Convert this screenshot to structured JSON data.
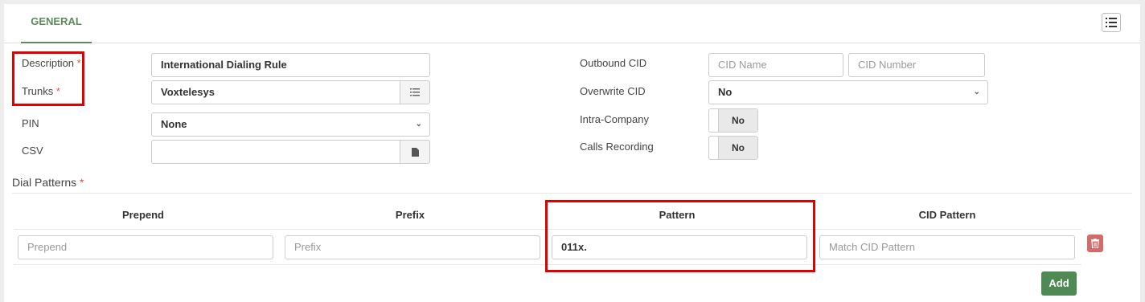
{
  "tabs": [
    {
      "label": "GENERAL"
    }
  ],
  "form": {
    "description": {
      "label": "Description",
      "required": "*",
      "value": "International Dialing Rule"
    },
    "trunks": {
      "label": "Trunks",
      "required": "*",
      "value": "Voxtelesys"
    },
    "pin": {
      "label": "PIN",
      "value": "None"
    },
    "csv": {
      "label": "CSV",
      "value": ""
    },
    "outbound_cid": {
      "label": "Outbound CID",
      "name_placeholder": "CID Name",
      "number_placeholder": "CID Number"
    },
    "overwrite_cid": {
      "label": "Overwrite CID",
      "value": "No"
    },
    "intra_company": {
      "label": "Intra-Company",
      "value": "No"
    },
    "calls_recording": {
      "label": "Calls Recording",
      "value": "No"
    }
  },
  "dial_patterns": {
    "title": "Dial Patterns",
    "required": "*",
    "headers": [
      "Prepend",
      "Prefix",
      "Pattern",
      "CID Pattern"
    ],
    "row": {
      "prepend_placeholder": "Prepend",
      "prefix_placeholder": "Prefix",
      "pattern_value": "011x.",
      "cid_pattern_placeholder": "Match CID Pattern"
    },
    "add_label": "Add"
  },
  "icons": {
    "menu": "list-icon",
    "trunks_addon": "list-icon",
    "csv_addon": "file-icon",
    "delete": "trash-icon",
    "select_caret": "chevron-down-icon"
  },
  "colors": {
    "accent": "#5b8c5a",
    "required": "#d9534f",
    "highlight": "#e00000",
    "danger": "#d46b6b",
    "success": "#4f8a55"
  }
}
